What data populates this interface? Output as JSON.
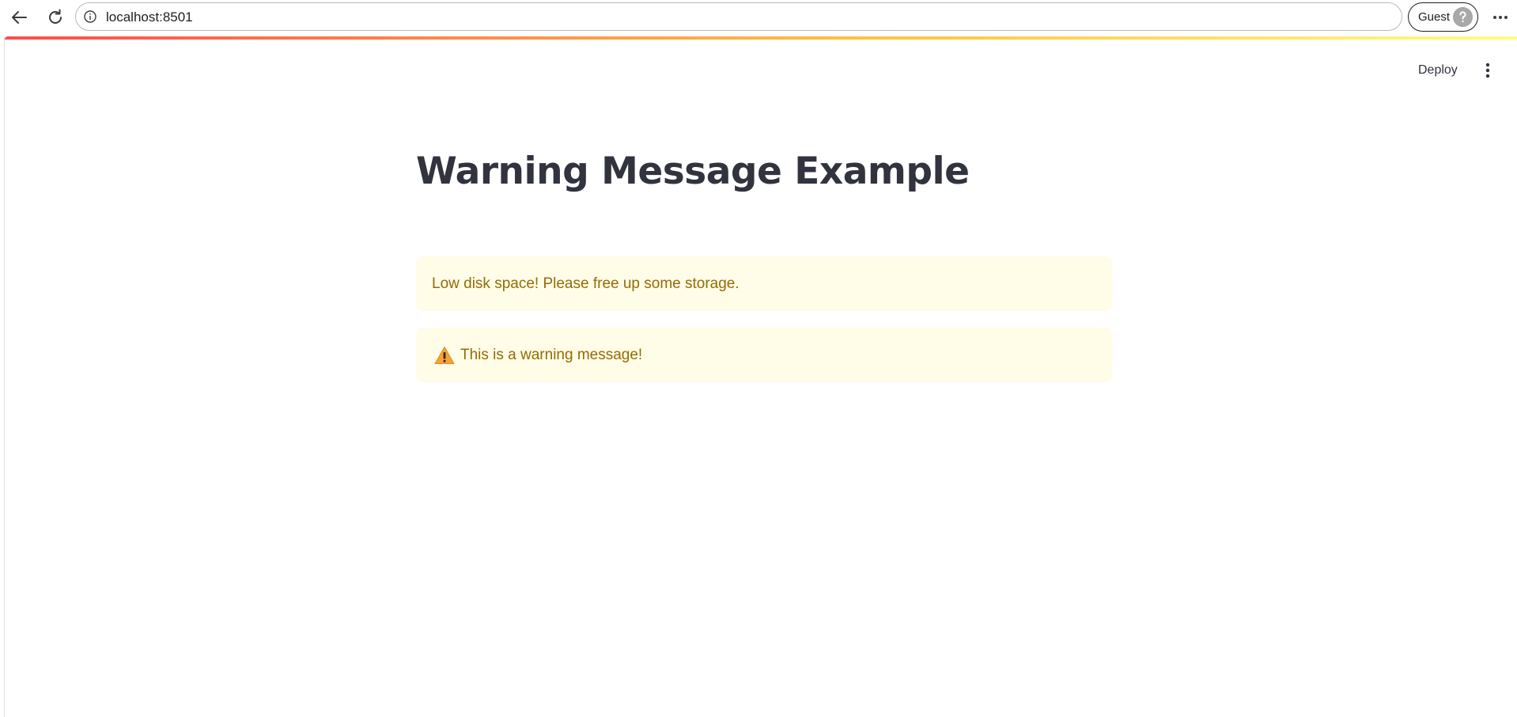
{
  "browser": {
    "url": "localhost:8501",
    "profile_label": "Guest"
  },
  "app": {
    "deploy_label": "Deploy",
    "title": "Warning Message Example",
    "alerts": [
      {
        "text": "Low disk space! Please free up some storage.",
        "icon": null
      },
      {
        "text": "This is a warning message!",
        "icon": "warning-icon"
      }
    ],
    "colors": {
      "alert_background": "#fffce7",
      "alert_text": "#926c05",
      "title_text": "#31333f",
      "decoration_gradient": [
        "#ff4b4b",
        "#ffbd45",
        "#fffd80"
      ]
    }
  }
}
